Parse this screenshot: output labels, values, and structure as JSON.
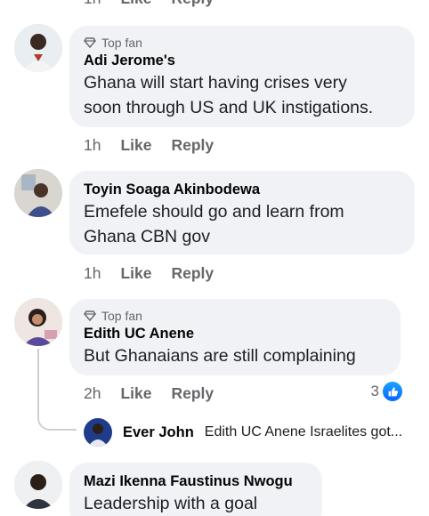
{
  "top_partial": {
    "time": "1h",
    "like": "Like",
    "reply": "Reply"
  },
  "comments": [
    {
      "badge": "Top fan",
      "author": "Adi Jerome's",
      "text_lines": [
        "Ghana will start having crises very",
        "soon through US and UK instigations."
      ],
      "time": "1h",
      "like": "Like",
      "reply": "Reply"
    },
    {
      "author": "Toyin Soaga Akinbodewa",
      "text_lines": [
        "Emefele should go and learn from",
        "Ghana CBN gov"
      ],
      "time": "1h",
      "like": "Like",
      "reply": "Reply"
    },
    {
      "badge": "Top fan",
      "author": "Edith UC Anene",
      "text_lines": [
        "But Ghanaians are still complaining"
      ],
      "time": "2h",
      "like": "Like",
      "reply": "Reply",
      "reaction_count": "3",
      "reply_preview": {
        "author": "Ever John",
        "snippet": "Edith UC Anene Israelites got..."
      }
    },
    {
      "author": "Mazi Ikenna Faustinus Nwogu",
      "text_lines": [
        "Leadership with a goal"
      ]
    }
  ],
  "icons": {
    "badge": "diamond-icon",
    "reaction": "thumbs-up-icon"
  },
  "colors": {
    "bubble": "#f0f2f5",
    "meta": "#65676b",
    "like_blue": "#0866ff"
  }
}
